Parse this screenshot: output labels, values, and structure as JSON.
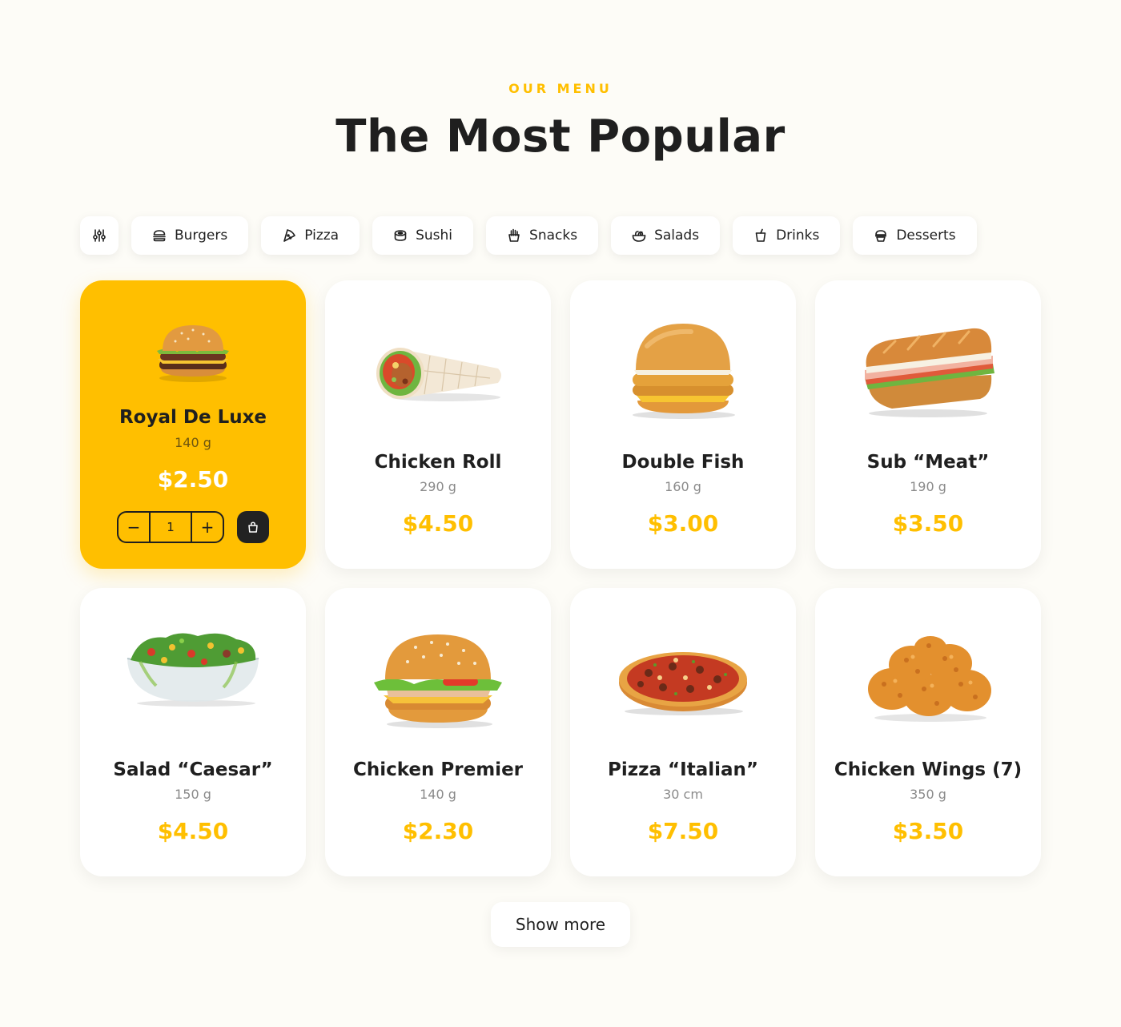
{
  "header": {
    "eyebrow": "OUR MENU",
    "title": "The Most Popular"
  },
  "filters": {
    "settings_icon": "sliders-icon",
    "items": [
      {
        "label": "Burgers",
        "icon": "burger-icon"
      },
      {
        "label": "Pizza",
        "icon": "pizza-slice-icon"
      },
      {
        "label": "Sushi",
        "icon": "sushi-icon"
      },
      {
        "label": "Snacks",
        "icon": "fries-icon"
      },
      {
        "label": "Salads",
        "icon": "salad-bowl-icon"
      },
      {
        "label": "Drinks",
        "icon": "cup-icon"
      },
      {
        "label": "Desserts",
        "icon": "cupcake-icon"
      }
    ]
  },
  "products": [
    {
      "name": "Royal De Luxe",
      "weight": "140 g",
      "price": "$2.50",
      "image": "double-burger",
      "selected": true,
      "quantity": "1"
    },
    {
      "name": "Chicken Roll",
      "weight": "290 g",
      "price": "$4.50",
      "image": "wrap-roll"
    },
    {
      "name": "Double Fish",
      "weight": "160 g",
      "price": "$3.00",
      "image": "fish-burger"
    },
    {
      "name": "Sub “Meat”",
      "weight": "190 g",
      "price": "$3.50",
      "image": "sub-sandwich"
    },
    {
      "name": "Salad “Caesar”",
      "weight": "150 g",
      "price": "$4.50",
      "image": "salad-bowl"
    },
    {
      "name": "Chicken Premier",
      "weight": "140 g",
      "price": "$2.30",
      "image": "chicken-burger"
    },
    {
      "name": "Pizza “Italian”",
      "weight": "30 cm",
      "price": "$7.50",
      "image": "pizza"
    },
    {
      "name": "Chicken Wings (7)",
      "weight": "350 g",
      "price": "$3.50",
      "image": "fried-chicken"
    }
  ],
  "stepper": {
    "minus": "−",
    "plus": "+"
  },
  "cart_icon": "shopping-bag-icon",
  "show_more_label": "Show more",
  "colors": {
    "accent": "#ffbf00",
    "background": "#fdfcf7",
    "text": "#1f1f1f",
    "muted": "#8a8a8a",
    "card": "#ffffff"
  }
}
